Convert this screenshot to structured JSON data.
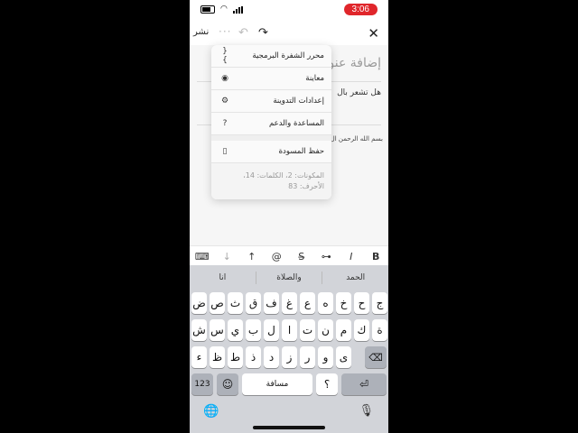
{
  "status_bar": {
    "time": "3:06"
  },
  "toolbar": {
    "publish": "نشر",
    "more": "···",
    "undo": "↶",
    "redo": "↷",
    "close": "✕"
  },
  "editor": {
    "title_placeholder": "إضافة عنو",
    "prompt": "هل تشعر بال",
    "body": "بسم الله الرحمن ال"
  },
  "menu": {
    "items": [
      {
        "label": "محرر الشفرة البرمجية",
        "icon": "{ }"
      },
      {
        "label": "معاينة",
        "icon": "◉"
      },
      {
        "label": "إعدادات التدوينة",
        "icon": "⚙"
      },
      {
        "label": "المساعدة والدعم",
        "icon": "?"
      }
    ],
    "save_draft": {
      "label": "حفظ المسودة",
      "icon": "▯"
    },
    "stats_line1": "المكونات: 2، الكلمات: 14،",
    "stats_line2": "الأحرف: 83"
  },
  "format_bar": [
    "⌨",
    "↓",
    "↑",
    "@",
    "S̶",
    "⊶",
    "I",
    "B"
  ],
  "keyboard": {
    "suggestions": [
      "انا",
      "والصلاة",
      "الحمد"
    ],
    "row1": [
      "ض",
      "ص",
      "ث",
      "ق",
      "ف",
      "غ",
      "ع",
      "ه",
      "خ",
      "ح",
      "ج"
    ],
    "row2": [
      "ش",
      "س",
      "ي",
      "ب",
      "ل",
      "ا",
      "ت",
      "ن",
      "م",
      "ك",
      "ة"
    ],
    "row3": [
      "ء",
      "ظ",
      "ط",
      "ذ",
      "د",
      "ز",
      "ر",
      "و",
      "ى"
    ],
    "numbers_key": "123",
    "emoji_key": "☺",
    "space_key": "مسافة",
    "punct_key": "؟",
    "return_key": "⏎",
    "delete_key": "⌫",
    "globe": "🌐",
    "mic": "🎙"
  }
}
